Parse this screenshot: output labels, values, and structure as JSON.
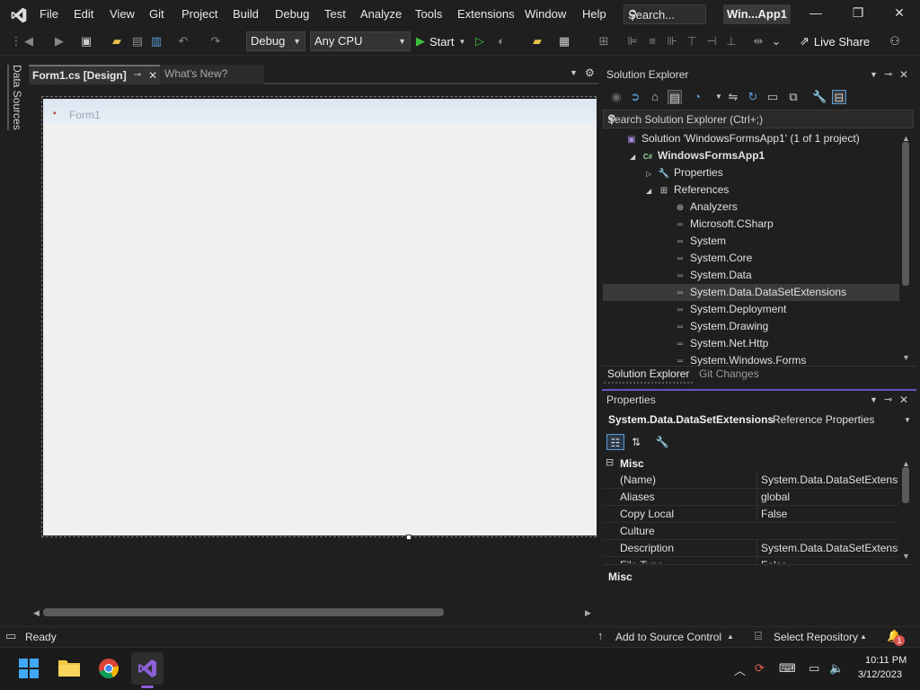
{
  "menu": {
    "items": [
      "File",
      "Edit",
      "View",
      "Git",
      "Project",
      "Build",
      "Debug",
      "Test",
      "Analyze",
      "Tools",
      "Extensions",
      "Window",
      "Help"
    ],
    "search_label": "Search...",
    "window_title": "Win...App1"
  },
  "toolbar": {
    "config": "Debug",
    "platform": "Any CPU",
    "start_label": "Start",
    "live_share_label": "Live Share"
  },
  "left_strip": {
    "data_sources_label": "Data Sources"
  },
  "tabs": {
    "active_label": "Form1.cs [Design]",
    "second_label": "What's New?"
  },
  "designer": {
    "form_title": "Form1"
  },
  "solution_explorer": {
    "title": "Solution Explorer",
    "search_placeholder": "Search Solution Explorer (Ctrl+;)",
    "tree": [
      {
        "label": "Solution 'WindowsFormsApp1' (1 of 1 project)",
        "indent": 0,
        "icon": "solution-icon",
        "expander": ""
      },
      {
        "label": "WindowsFormsApp1",
        "indent": 1,
        "icon": "csharp-project-icon",
        "expander": "expanded"
      },
      {
        "label": "Properties",
        "indent": 2,
        "icon": "wrench-icon",
        "expander": "collapsed"
      },
      {
        "label": "References",
        "indent": 2,
        "icon": "references-icon",
        "expander": "expanded"
      },
      {
        "label": "Analyzers",
        "indent": 3,
        "icon": "analyzers-icon",
        "expander": ""
      },
      {
        "label": "Microsoft.CSharp",
        "indent": 3,
        "icon": "reference-icon",
        "expander": ""
      },
      {
        "label": "System",
        "indent": 3,
        "icon": "reference-icon",
        "expander": ""
      },
      {
        "label": "System.Core",
        "indent": 3,
        "icon": "reference-icon",
        "expander": ""
      },
      {
        "label": "System.Data",
        "indent": 3,
        "icon": "reference-icon",
        "expander": ""
      },
      {
        "label": "System.Data.DataSetExtensions",
        "indent": 3,
        "icon": "reference-icon",
        "expander": "",
        "selected": true
      },
      {
        "label": "System.Deployment",
        "indent": 3,
        "icon": "reference-icon",
        "expander": ""
      },
      {
        "label": "System.Drawing",
        "indent": 3,
        "icon": "reference-icon",
        "expander": ""
      },
      {
        "label": "System.Net.Http",
        "indent": 3,
        "icon": "reference-icon",
        "expander": ""
      },
      {
        "label": "System.Windows.Forms",
        "indent": 3,
        "icon": "reference-icon",
        "expander": ""
      }
    ],
    "bottom_tabs": [
      "Solution Explorer",
      "Git Changes"
    ]
  },
  "properties": {
    "title": "Properties",
    "object_name": "System.Data.DataSetExtensions",
    "object_type": "Reference Properties",
    "category": "Misc",
    "rows": [
      {
        "name": "(Name)",
        "value": "System.Data.DataSetExtensions"
      },
      {
        "name": "Aliases",
        "value": "global"
      },
      {
        "name": "Copy Local",
        "value": "False"
      },
      {
        "name": "Culture",
        "value": ""
      },
      {
        "name": "Description",
        "value": "System.Data.DataSetExtensions"
      },
      {
        "name": "File Type",
        "value": "False"
      }
    ],
    "description_title": "Misc"
  },
  "status": {
    "ready": "Ready",
    "add_to_source_control": "Add to Source Control",
    "select_repository": "Select Repository",
    "notification_count": "1"
  },
  "taskbar": {
    "time": "10:11 PM",
    "date": "3/12/2023"
  },
  "colors": {
    "accent": "#6a4fc2",
    "vs_purple": "#8b5fd6",
    "start_green": "#3cc13c"
  }
}
